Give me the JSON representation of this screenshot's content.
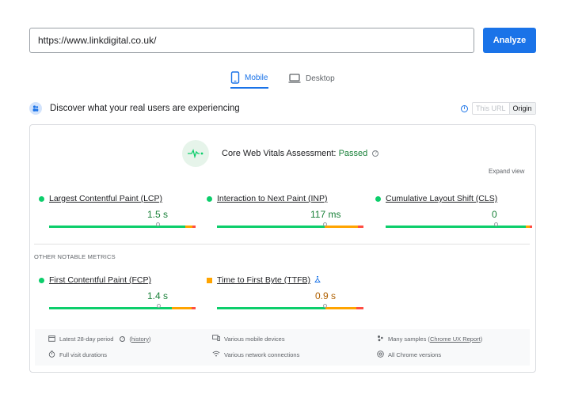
{
  "search": {
    "url_value": "https://www.linkdigital.co.uk/"
  },
  "toolbar": {
    "analyze_label": "Analyze"
  },
  "tabs": [
    {
      "label": "Mobile",
      "active": true,
      "icon": "smartphone-icon"
    },
    {
      "label": "Desktop",
      "active": false,
      "icon": "laptop-icon"
    }
  ],
  "discover": {
    "text": "Discover what your real users are experiencing",
    "icon": "people-icon"
  },
  "toggle": {
    "off_label": "This URL",
    "on_label": "Origin"
  },
  "assessment": {
    "prefix": "Core Web Vitals Assessment:",
    "status": "Passed",
    "expand_label": "Expand view"
  },
  "metrics": [
    {
      "label": "Largest Contentful Paint (LCP)",
      "value": "1.5 s",
      "rating": "good",
      "marker_fraction": 0.82
    },
    {
      "label": "Interaction to Next Paint (INP)",
      "value": "117 ms",
      "rating": "good",
      "marker_fraction": 0.74
    },
    {
      "label": "Cumulative Layout Shift (CLS)",
      "value": "0",
      "rating": "good",
      "marker_fraction": 0.75
    }
  ],
  "other": {
    "heading": "OTHER NOTABLE METRICS",
    "metrics": [
      {
        "label": "First Contentful Paint (FCP)",
        "value": "1.4 s",
        "rating": "good",
        "marker_fraction": 0.75
      },
      {
        "label": "Time to First Byte (TTFB)",
        "value": "0.9 s",
        "rating": "needs-improvement",
        "marker_fraction": 0.74,
        "badge_icon": "experimental-flask-icon"
      }
    ]
  },
  "info": {
    "period": "Latest 28-day period",
    "history": "history",
    "devices": "Various mobile devices",
    "samples_prefix": "Many samples (",
    "samples_link": "Chrome UX Report",
    "samples_suffix": ")",
    "durations": "Full visit durations",
    "network": "Various network connections",
    "versions": "All Chrome versions"
  },
  "colors": {
    "accent": "#1a73e8",
    "good": "#0cce6b",
    "average": "#ffa400",
    "poor": "#ff4e42",
    "passed_text": "#188038"
  }
}
